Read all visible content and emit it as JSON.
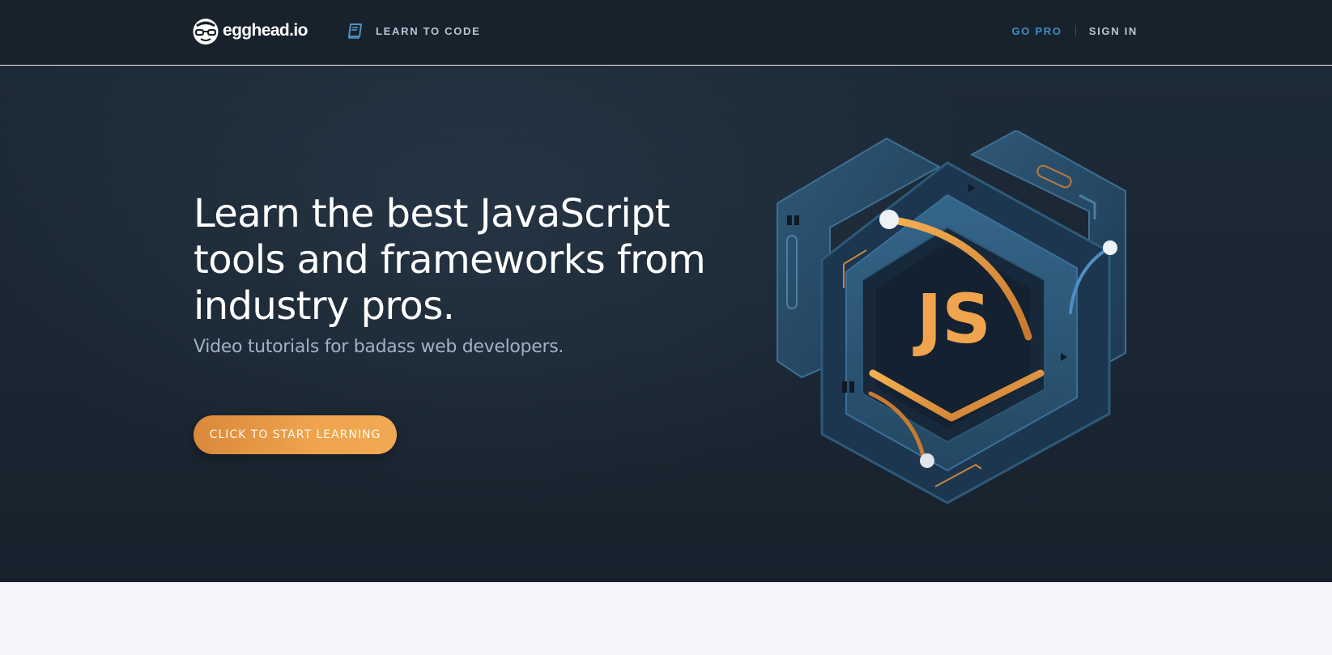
{
  "header": {
    "logo_text": "egghead.io",
    "learn_link": "LEARN TO CODE",
    "go_pro": "GO PRO",
    "sign_in": "SIGN IN"
  },
  "hero": {
    "headline": "Learn the best JavaScript tools and frameworks from industry pros.",
    "subhead": "Video tutorials for badass web developers.",
    "cta_label": "CLICK TO START LEARNING",
    "art_label": "JS"
  },
  "icons": {
    "logo": "egghead-logo-icon",
    "learn": "book-icon"
  },
  "colors": {
    "nav_bg": "#18222c",
    "hero_bg": "#1b2733",
    "accent_orange": "#f0a44d",
    "go_pro_blue": "#3f8fbf",
    "page_bg": "#f4f5f9"
  }
}
